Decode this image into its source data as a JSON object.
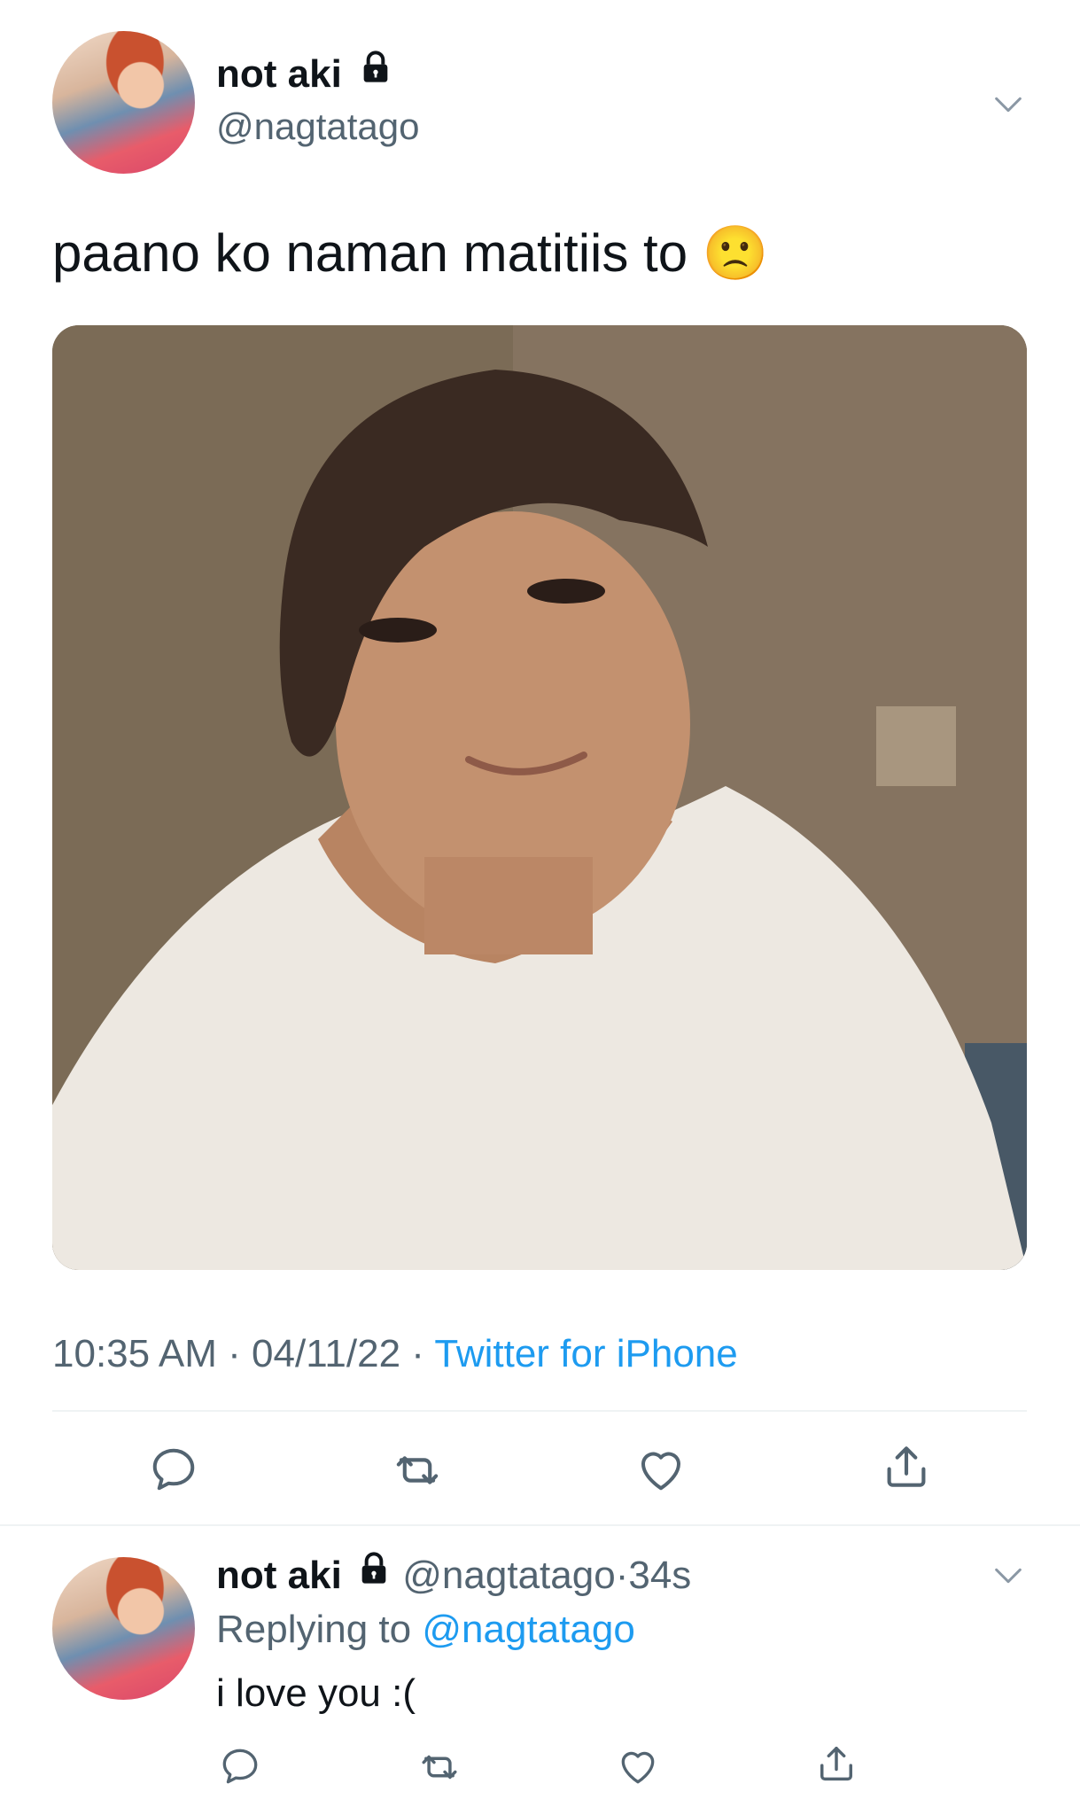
{
  "main_tweet": {
    "display_name": "not aki",
    "handle": "@nagtatago",
    "text": "paano ko naman matitiis to 🙁",
    "time": "10:35 AM",
    "date": "04/11/22",
    "source": "Twitter for iPhone",
    "separator": "·",
    "avatar_icon": "profile-photo",
    "photo_icon": "tweet-photo"
  },
  "reply_tweet": {
    "display_name": "not aki",
    "handle": "@nagtatago",
    "separator": "·",
    "age": "34s",
    "replying_prefix": "Replying to",
    "replying_handle": "@nagtatago",
    "text": "i love you :("
  },
  "icons": {
    "lock": "lock-icon",
    "caret": "chevron-down-icon",
    "reply": "reply-icon",
    "retweet": "retweet-icon",
    "like": "heart-icon",
    "share": "share-icon"
  },
  "colors": {
    "link": "#1d9bf0",
    "secondary_text": "#536471",
    "icon": "#536471",
    "divider": "#eff3f4"
  }
}
